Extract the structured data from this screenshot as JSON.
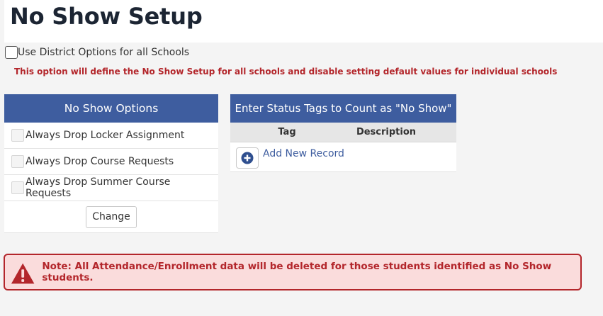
{
  "page": {
    "title": "No Show Setup"
  },
  "district": {
    "checkbox_label": "Use District Options for all Schools",
    "warning": "This option will define the No Show Setup for all schools and disable setting default values for individual schools"
  },
  "options_panel": {
    "header": "No Show Options",
    "items": [
      {
        "label": "Always Drop Locker Assignment"
      },
      {
        "label": "Always Drop Course Requests"
      },
      {
        "label": "Always Drop Summer Course Requests"
      }
    ],
    "change_button": "Change"
  },
  "tags_panel": {
    "header": "Enter Status Tags to Count as \"No Show\"",
    "columns": [
      "Tag",
      "Description"
    ],
    "add_link": "Add New Record",
    "add_icon": "plus-circle-icon"
  },
  "alert": {
    "icon": "warning-triangle-icon",
    "text": "Note: All Attendance/Enrollment data will be deleted for those students identified as No Show students."
  },
  "colors": {
    "header_blue": "#3e5d9f",
    "warning_red": "#b3262b",
    "alert_bg": "#fadcdc"
  }
}
